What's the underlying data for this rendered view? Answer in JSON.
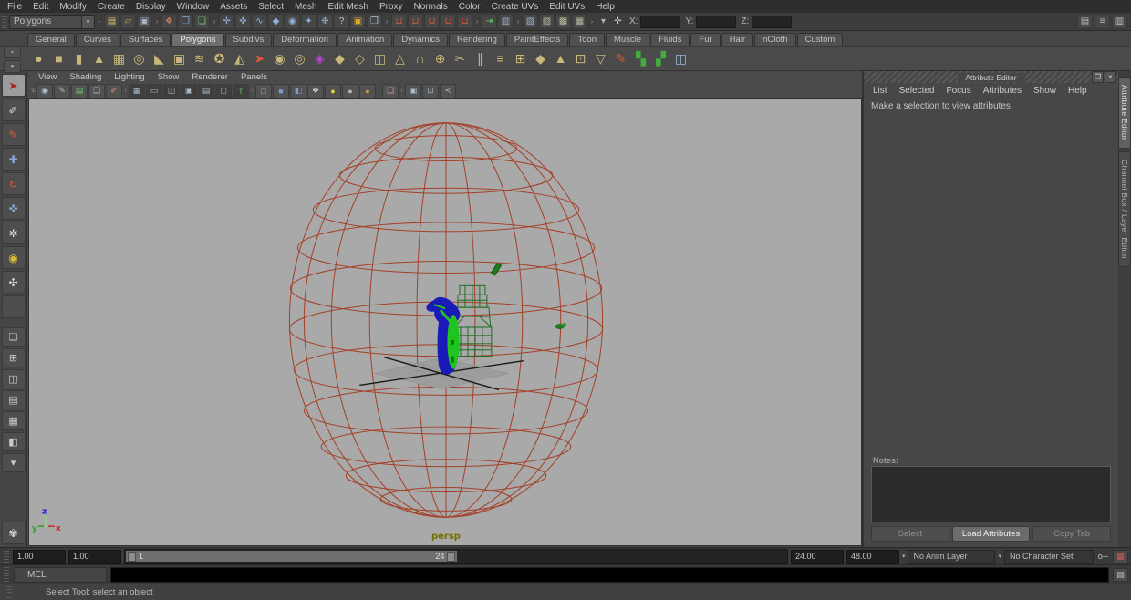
{
  "colors": {
    "viewport_bg": "#a9a9a9",
    "wireframe_red": "#a43a20",
    "object_blue": "#1a1ab8",
    "object_green": "#1fc41f",
    "tower_green": "#1d6c26",
    "persp_label": "#6f7000",
    "active_tab": "#6f6f6f"
  },
  "menubar": {
    "items": [
      {
        "name": "menu-file",
        "label": "File"
      },
      {
        "name": "menu-edit",
        "label": "Edit"
      },
      {
        "name": "menu-modify",
        "label": "Modify"
      },
      {
        "name": "menu-create",
        "label": "Create"
      },
      {
        "name": "menu-display",
        "label": "Display"
      },
      {
        "name": "menu-window",
        "label": "Window"
      },
      {
        "name": "menu-assets",
        "label": "Assets"
      },
      {
        "name": "menu-select",
        "label": "Select"
      },
      {
        "name": "menu-mesh",
        "label": "Mesh"
      },
      {
        "name": "menu-edit-mesh",
        "label": "Edit Mesh"
      },
      {
        "name": "menu-proxy",
        "label": "Proxy"
      },
      {
        "name": "menu-normals",
        "label": "Normals"
      },
      {
        "name": "menu-color",
        "label": "Color"
      },
      {
        "name": "menu-create-uvs",
        "label": "Create UVs"
      },
      {
        "name": "menu-edit-uvs",
        "label": "Edit UVs"
      },
      {
        "name": "menu-help",
        "label": "Help"
      }
    ]
  },
  "statusline": {
    "menuset": "Polygons",
    "sep_glyph": "›",
    "dropdown_arrow": "▾",
    "x_label": "X:",
    "y_label": "Y:",
    "z_label": "Z:",
    "x_value": "",
    "y_value": "",
    "z_value": "",
    "file_icons": [
      {
        "name": "new-scene-icon",
        "glyph": "▤",
        "color": "#d8c868"
      },
      {
        "name": "open-scene-icon",
        "glyph": "▱",
        "color": "#c89a50"
      },
      {
        "name": "save-scene-icon",
        "glyph": "▣",
        "color": "#aab2c0"
      }
    ],
    "select_mode_icons": [
      {
        "name": "select-hierarchy-icon",
        "glyph": "❖",
        "color": "#c87a5a"
      },
      {
        "name": "select-object-icon",
        "glyph": "❐",
        "color": "#7aa0d0"
      },
      {
        "name": "select-component-icon",
        "glyph": "❑",
        "color": "#6ac86a"
      }
    ],
    "mask_icons": [
      {
        "name": "mask-handles-icon",
        "glyph": "✛",
        "color": "#8fb2d8"
      },
      {
        "name": "mask-joints-icon",
        "glyph": "✜",
        "color": "#8fb2d8"
      },
      {
        "name": "mask-curves-icon",
        "glyph": "∿",
        "color": "#8fb2d8"
      },
      {
        "name": "mask-surfaces-icon",
        "glyph": "◆",
        "color": "#8fb2d8"
      },
      {
        "name": "mask-deformations-icon",
        "glyph": "◉",
        "color": "#8fb2d8"
      },
      {
        "name": "mask-dynamics-icon",
        "glyph": "✦",
        "color": "#8fb2d8"
      },
      {
        "name": "mask-rendering-icon",
        "glyph": "❉",
        "color": "#8fb2d8"
      },
      {
        "name": "mask-misc-icon",
        "glyph": "?",
        "color": "#b8c8d8"
      }
    ],
    "lock_icons": [
      {
        "name": "lock-selection-icon",
        "glyph": "▣",
        "color": "#d8aa28"
      },
      {
        "name": "highlight-selection-icon",
        "glyph": "❒",
        "color": "#9ab8d8"
      }
    ],
    "snap_icons": [
      {
        "name": "snap-grid-icon",
        "glyph": "⊔",
        "color": "#d85838"
      },
      {
        "name": "snap-curve-icon",
        "glyph": "⊔",
        "color": "#d85838"
      },
      {
        "name": "snap-point-icon",
        "glyph": "⊔",
        "color": "#d85838"
      },
      {
        "name": "snap-view-plane-icon",
        "glyph": "⊔",
        "color": "#d85838"
      },
      {
        "name": "make-live-icon",
        "glyph": "⊔",
        "color": "#d85838"
      }
    ],
    "history_icons": [
      {
        "name": "construction-history-icon",
        "glyph": "⇥",
        "color": "#6ac86a"
      },
      {
        "name": "input-line-icon",
        "glyph": "▥",
        "color": "#9ab0c8"
      }
    ],
    "render_icons": [
      {
        "name": "render-view-icon",
        "glyph": "▧",
        "color": "#9ab8d8"
      },
      {
        "name": "render-current-frame-icon",
        "glyph": "▨",
        "color": "#b8b89a"
      },
      {
        "name": "ipr-render-icon",
        "glyph": "▩",
        "color": "#b8b89a"
      },
      {
        "name": "render-settings-icon",
        "glyph": "▦",
        "color": "#b8b89a"
      }
    ],
    "selector_icons": [
      {
        "name": "input-selector-arrow-icon",
        "glyph": "▾",
        "color": "#b0b0b0"
      },
      {
        "name": "absolute-transform-icon",
        "glyph": "✛",
        "color": "#c0c0c0"
      }
    ],
    "panel_toggle_icons": [
      {
        "name": "toggle-attribute-editor-icon",
        "glyph": "▤",
        "color": "#b8c0c8"
      },
      {
        "name": "toggle-tool-settings-icon",
        "glyph": "≡",
        "color": "#b8c0c8"
      },
      {
        "name": "toggle-channel-box-icon",
        "glyph": "▥",
        "color": "#b8c0c8"
      }
    ]
  },
  "shelf": {
    "menu_buttons": [
      {
        "name": "shelf-menu-icon",
        "glyph": "▪"
      },
      {
        "name": "shelf-arrow-icon",
        "glyph": "▾"
      }
    ],
    "tabs": [
      {
        "name": "tab-general",
        "label": "General"
      },
      {
        "name": "tab-curves",
        "label": "Curves"
      },
      {
        "name": "tab-surfaces",
        "label": "Surfaces"
      },
      {
        "name": "tab-polygons",
        "label": "Polygons",
        "active": true
      },
      {
        "name": "tab-subdivs",
        "label": "Subdivs"
      },
      {
        "name": "tab-deformation",
        "label": "Deformation"
      },
      {
        "name": "tab-animation",
        "label": "Animation"
      },
      {
        "name": "tab-dynamics",
        "label": "Dynamics"
      },
      {
        "name": "tab-rendering",
        "label": "Rendering"
      },
      {
        "name": "tab-painteffects",
        "label": "PaintEffects"
      },
      {
        "name": "tab-toon",
        "label": "Toon"
      },
      {
        "name": "tab-muscle",
        "label": "Muscle"
      },
      {
        "name": "tab-fluids",
        "label": "Fluids"
      },
      {
        "name": "tab-fur",
        "label": "Fur"
      },
      {
        "name": "tab-hair",
        "label": "Hair"
      },
      {
        "name": "tab-ncloth",
        "label": "nCloth"
      },
      {
        "name": "tab-custom",
        "label": "Custom"
      }
    ],
    "icons": [
      {
        "name": "poly-sphere-icon",
        "glyph": "●"
      },
      {
        "name": "poly-cube-icon",
        "glyph": "■"
      },
      {
        "name": "poly-cylinder-icon",
        "glyph": "▮"
      },
      {
        "name": "poly-cone-icon",
        "glyph": "▲"
      },
      {
        "name": "poly-plane-icon",
        "glyph": "▦"
      },
      {
        "name": "poly-torus-icon",
        "glyph": "◎"
      },
      {
        "name": "poly-prism-icon",
        "glyph": "◣"
      },
      {
        "name": "poly-pipe-icon",
        "glyph": "▣"
      },
      {
        "name": "poly-helix-icon",
        "glyph": "≋"
      },
      {
        "name": "poly-soccer-ball-icon",
        "glyph": "✪"
      },
      {
        "name": "poly-platonic-icon",
        "glyph": "◭"
      },
      {
        "name": "curve-arrow-icon",
        "glyph": "➤",
        "color": "#d85838"
      },
      {
        "name": "sphere-pair-icon",
        "glyph": "◉"
      },
      {
        "name": "sphere-combine-icon",
        "glyph": "◎"
      },
      {
        "name": "booleans-icon",
        "glyph": "◈",
        "color": "#b048c8"
      },
      {
        "name": "combine-icon",
        "glyph": "◆"
      },
      {
        "name": "extract-icon",
        "glyph": "◇"
      },
      {
        "name": "separate-icon",
        "glyph": "◫"
      },
      {
        "name": "extrude-icon",
        "glyph": "△"
      },
      {
        "name": "bridge-icon",
        "glyph": "∩"
      },
      {
        "name": "merge-icon",
        "glyph": "⊕"
      },
      {
        "name": "split-polygon-icon",
        "glyph": "✂"
      },
      {
        "name": "insert-edge-loop-icon",
        "glyph": "∥"
      },
      {
        "name": "offset-edge-loop-icon",
        "glyph": "≡"
      },
      {
        "name": "add-divisions-icon",
        "glyph": "⊞"
      },
      {
        "name": "bevel-icon",
        "glyph": "◆"
      },
      {
        "name": "triangulate-icon",
        "glyph": "▲"
      },
      {
        "name": "quadrangulate-icon",
        "glyph": "⊡"
      },
      {
        "name": "reduce-icon",
        "glyph": "▽"
      },
      {
        "name": "sculpt-icon",
        "glyph": "✎",
        "color": "#d85838"
      },
      {
        "name": "uv-checker-green-icon",
        "glyph": "▚",
        "color": "#3fae3f"
      },
      {
        "name": "uv-checker-dark-icon",
        "glyph": "▞",
        "color": "#3fae3f"
      },
      {
        "name": "uv-texture-editor-icon",
        "glyph": "◫",
        "color": "#9ab8d8"
      }
    ]
  },
  "toolbox": {
    "tools": [
      {
        "name": "select-tool",
        "glyph": "➤",
        "active": true
      },
      {
        "name": "lasso-tool",
        "glyph": "✐"
      },
      {
        "name": "paint-selection-tool",
        "glyph": "✎",
        "color": "#d85838"
      },
      {
        "name": "move-tool",
        "glyph": "✚",
        "color": "#88a8d8"
      },
      {
        "name": "rotate-tool",
        "glyph": "↻",
        "color": "#d85838"
      },
      {
        "name": "scale-tool",
        "glyph": "✜",
        "color": "#88a8d8"
      },
      {
        "name": "universal-manipulator-tool",
        "glyph": "✲"
      },
      {
        "name": "soft-modification-tool",
        "glyph": "◉",
        "color": "#d8b838"
      },
      {
        "name": "show-manipulator-tool",
        "glyph": "✣"
      },
      {
        "name": "last-tool",
        "glyph": ""
      }
    ],
    "layouts": [
      {
        "name": "layout-single-persp",
        "glyph": "❏"
      },
      {
        "name": "layout-four-view",
        "glyph": "⊞"
      },
      {
        "name": "layout-persp-outliner",
        "glyph": "◫"
      },
      {
        "name": "layout-persp-graph",
        "glyph": "▤"
      },
      {
        "name": "layout-hypershade-persp",
        "glyph": "▦"
      },
      {
        "name": "layout-persp-hypergraph",
        "glyph": "◧"
      },
      {
        "name": "layout-menu-arrow",
        "glyph": "▾"
      }
    ],
    "paw_glyph": "✾"
  },
  "viewport": {
    "menus": [
      {
        "name": "panel-menu-view",
        "label": "View"
      },
      {
        "name": "panel-menu-shading",
        "label": "Shading"
      },
      {
        "name": "panel-menu-lighting",
        "label": "Lighting"
      },
      {
        "name": "panel-menu-show",
        "label": "Show"
      },
      {
        "name": "panel-menu-renderer",
        "label": "Renderer"
      },
      {
        "name": "panel-menu-panels",
        "label": "Panels"
      }
    ],
    "icons_a": [
      {
        "name": "select-camera-icon",
        "glyph": "◉"
      },
      {
        "name": "camera-attributes-icon",
        "glyph": "✎"
      },
      {
        "name": "bookmarks-icon",
        "glyph": "▤",
        "color": "#6ac86a"
      },
      {
        "name": "image-plane-icon",
        "glyph": "❏"
      },
      {
        "name": "grease-pencil-icon",
        "glyph": "✐",
        "color": "#d88a7a"
      }
    ],
    "icons_b": [
      {
        "name": "grid-icon",
        "glyph": "▦"
      },
      {
        "name": "film-gate-icon",
        "glyph": "▭"
      },
      {
        "name": "resolution-gate-icon",
        "glyph": "◫"
      },
      {
        "name": "gate-mask-icon",
        "glyph": "▣"
      },
      {
        "name": "field-chart-icon",
        "glyph": "▤"
      },
      {
        "name": "safe-action-icon",
        "glyph": "◻"
      },
      {
        "name": "safe-title-icon",
        "glyph": "T",
        "color": "#6ac86a"
      }
    ],
    "icons_c": [
      {
        "name": "wireframe-icon",
        "glyph": "□"
      },
      {
        "name": "smooth-shade-all-icon",
        "glyph": "■",
        "color": "#7a9ac8"
      },
      {
        "name": "shade-textured-icon",
        "glyph": "◧",
        "color": "#7a9ac8"
      },
      {
        "name": "use-default-material-icon",
        "glyph": "❖",
        "color": "#d0d0d0"
      },
      {
        "name": "all-lights-icon",
        "glyph": "●",
        "color": "#d8d830"
      },
      {
        "name": "no-lights-icon",
        "glyph": "●",
        "color": "#b8b8b8"
      },
      {
        "name": "default-lighting-icon",
        "glyph": "●",
        "color": "#c89a40"
      }
    ],
    "icons_d": [
      {
        "name": "isolate-select-icon",
        "glyph": "❑",
        "color": "#c89a8a"
      }
    ],
    "icons_e": [
      {
        "name": "xray-icon",
        "glyph": "▣"
      },
      {
        "name": "wireframe-on-shaded-icon",
        "glyph": "⊡"
      },
      {
        "name": "connections-icon",
        "glyph": "≺"
      }
    ],
    "camera_label": "persp",
    "axis": {
      "x": "x",
      "y": "y",
      "z": "z"
    }
  },
  "attribute_editor": {
    "title": "Attribute Editor",
    "window_icons": [
      {
        "name": "float-panel-icon",
        "glyph": "❐"
      },
      {
        "name": "close-panel-icon",
        "glyph": "×"
      }
    ],
    "menus": [
      {
        "name": "ae-menu-list",
        "label": "List"
      },
      {
        "name": "ae-menu-selected",
        "label": "Selected"
      },
      {
        "name": "ae-menu-focus",
        "label": "Focus"
      },
      {
        "name": "ae-menu-attributes",
        "label": "Attributes"
      },
      {
        "name": "ae-menu-show",
        "label": "Show"
      },
      {
        "name": "ae-menu-help",
        "label": "Help"
      }
    ],
    "message": "Make a selection to view attributes",
    "notes_label": "Notes:",
    "buttons": {
      "select": "Select",
      "load": "Load Attributes",
      "copy": "Copy Tab"
    }
  },
  "side_tabs": [
    {
      "name": "side-tab-attribute-editor",
      "label": "Attribute Editor",
      "active": true
    },
    {
      "name": "side-tab-channel-box",
      "label": "Channel Box / Layer Editor"
    }
  ],
  "range_slider": {
    "anim_start": "1.00",
    "playback_start": "1.00",
    "bar_start_label": "1",
    "bar_end_label": "24",
    "playback_end": "24.00",
    "anim_end": "48.00",
    "anim_layer": "No Anim Layer",
    "character_set": "No Character Set",
    "dropdown_arrow": "▾",
    "auto_keyframe_glyph": "o─",
    "anim_prefs_glyph": "▦"
  },
  "command_line": {
    "label": "MEL",
    "value": "",
    "script_editor_glyph": "▤"
  },
  "help_line": {
    "text": "Select Tool: select an object"
  }
}
